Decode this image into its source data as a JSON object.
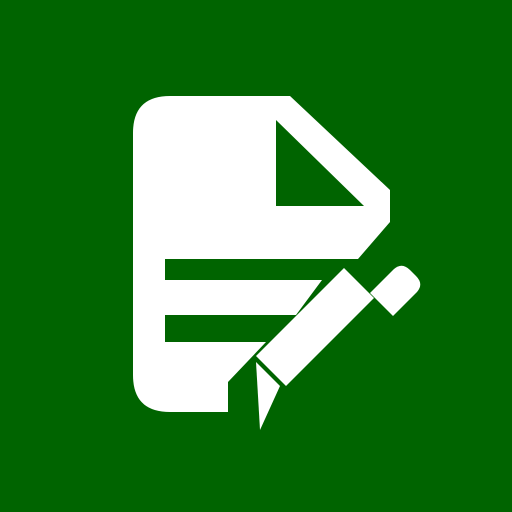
{
  "icon": {
    "name": "document-edit-icon",
    "background_color": "#006400",
    "foreground_color": "#FFFFFF"
  }
}
